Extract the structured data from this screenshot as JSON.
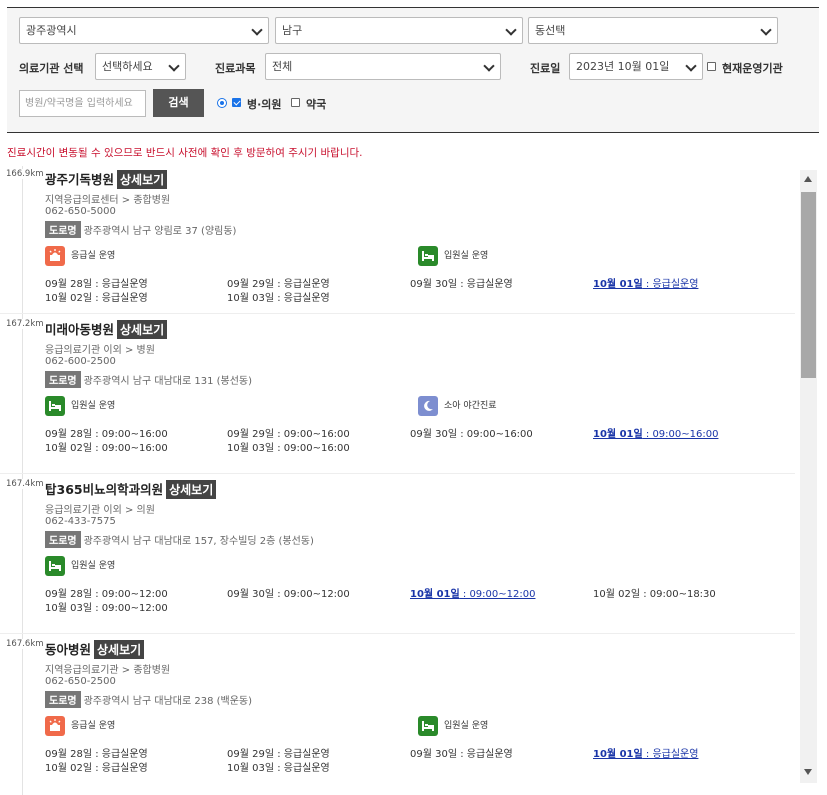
{
  "filters": {
    "region": "광주광역시",
    "district": "남구",
    "dong": "동선택",
    "institution_label": "의료기관 선택",
    "institution_value": "선택하세요",
    "department_label": "진료과목",
    "department_value": "전체",
    "date_label": "진료일",
    "date_value": "2023년 10월 01일",
    "current_open_label": "현재운영기관",
    "search_placeholder": "병원/약국명을 입력하세요",
    "search_button": "검색",
    "hospital_label": "병·의원",
    "pharmacy_label": "약국"
  },
  "notice": "진료시간이 변동될 수 있으므로 반드시 사전에 확인 후 방문하여 주시기 바랍니다.",
  "detail_label": "상세보기",
  "road_label": "도로명",
  "entries": [
    {
      "distance": "166.9km",
      "name": "광주기독병원",
      "category": "지역응급의료센터 > 종합병원",
      "phone": "062-650-5000",
      "address": "광주광역시 남구 양림로 37 (양림동)",
      "services": [
        {
          "icon": "ambulance-icon",
          "color": "red",
          "label": "응급실 운영"
        },
        {
          "icon": "bed-icon",
          "color": "green",
          "label": "입원실 운영"
        }
      ],
      "hours": [
        {
          "day": "09월 28일",
          "time": "응급실운영",
          "today": false
        },
        {
          "day": "09월 29일",
          "time": "응급실운영",
          "today": false
        },
        {
          "day": "09월 30일",
          "time": "응급실운영",
          "today": false
        },
        {
          "day": "10월 01일",
          "time": "응급실운영",
          "today": true
        },
        {
          "day": "10월 02일",
          "time": "응급실운영",
          "today": false
        },
        {
          "day": "10월 03일",
          "time": "응급실운영",
          "today": false
        }
      ]
    },
    {
      "distance": "167.2km",
      "name": "미래아동병원",
      "category": "응급의료기관 이외 > 병원",
      "phone": "062-600-2500",
      "address": "광주광역시 남구 대남대로 131 (봉선동)",
      "services": [
        {
          "icon": "bed-icon",
          "color": "green",
          "label": "입원실 운영"
        },
        {
          "icon": "moon-icon",
          "color": "blue",
          "label": "소아 야간진료"
        }
      ],
      "hours": [
        {
          "day": "09월 28일",
          "time": "09:00~16:00",
          "today": false
        },
        {
          "day": "09월 29일",
          "time": "09:00~16:00",
          "today": false
        },
        {
          "day": "09월 30일",
          "time": "09:00~16:00",
          "today": false
        },
        {
          "day": "10월 01일",
          "time": "09:00~16:00",
          "today": true
        },
        {
          "day": "10월 02일",
          "time": "09:00~16:00",
          "today": false
        },
        {
          "day": "10월 03일",
          "time": "09:00~16:00",
          "today": false
        }
      ]
    },
    {
      "distance": "167.4km",
      "name": "탑365비뇨의학과의원",
      "category": "응급의료기관 이외 > 의원",
      "phone": "062-433-7575",
      "address": "광주광역시 남구 대남대로 157, 장수빌딩 2층 (봉선동)",
      "services": [
        {
          "icon": "bed-icon",
          "color": "green",
          "label": "입원실 운영"
        }
      ],
      "hours": [
        {
          "day": "09월 28일",
          "time": "09:00~12:00",
          "today": false
        },
        {
          "day": "09월 30일",
          "time": "09:00~12:00",
          "today": false
        },
        {
          "day": "10월 01일",
          "time": "09:00~12:00",
          "today": true
        },
        {
          "day": "10월 02일",
          "time": "09:00~18:30",
          "today": false
        },
        {
          "day": "10월 03일",
          "time": "09:00~12:00",
          "today": false
        }
      ]
    },
    {
      "distance": "167.6km",
      "name": "동아병원",
      "category": "지역응급의료기관 > 종합병원",
      "phone": "062-650-2500",
      "address": "광주광역시 남구 대남대로 238 (백운동)",
      "services": [
        {
          "icon": "ambulance-icon",
          "color": "red",
          "label": "응급실 운영"
        },
        {
          "icon": "bed-icon",
          "color": "green",
          "label": "입원실 운영"
        }
      ],
      "hours": [
        {
          "day": "09월 28일",
          "time": "응급실운영",
          "today": false
        },
        {
          "day": "09월 29일",
          "time": "응급실운영",
          "today": false
        },
        {
          "day": "09월 30일",
          "time": "응급실운영",
          "today": false
        },
        {
          "day": "10월 01일",
          "time": "응급실운영",
          "today": true
        },
        {
          "day": "10월 02일",
          "time": "응급실운영",
          "today": false
        },
        {
          "day": "10월 03일",
          "time": "응급실운영",
          "today": false
        }
      ]
    }
  ]
}
